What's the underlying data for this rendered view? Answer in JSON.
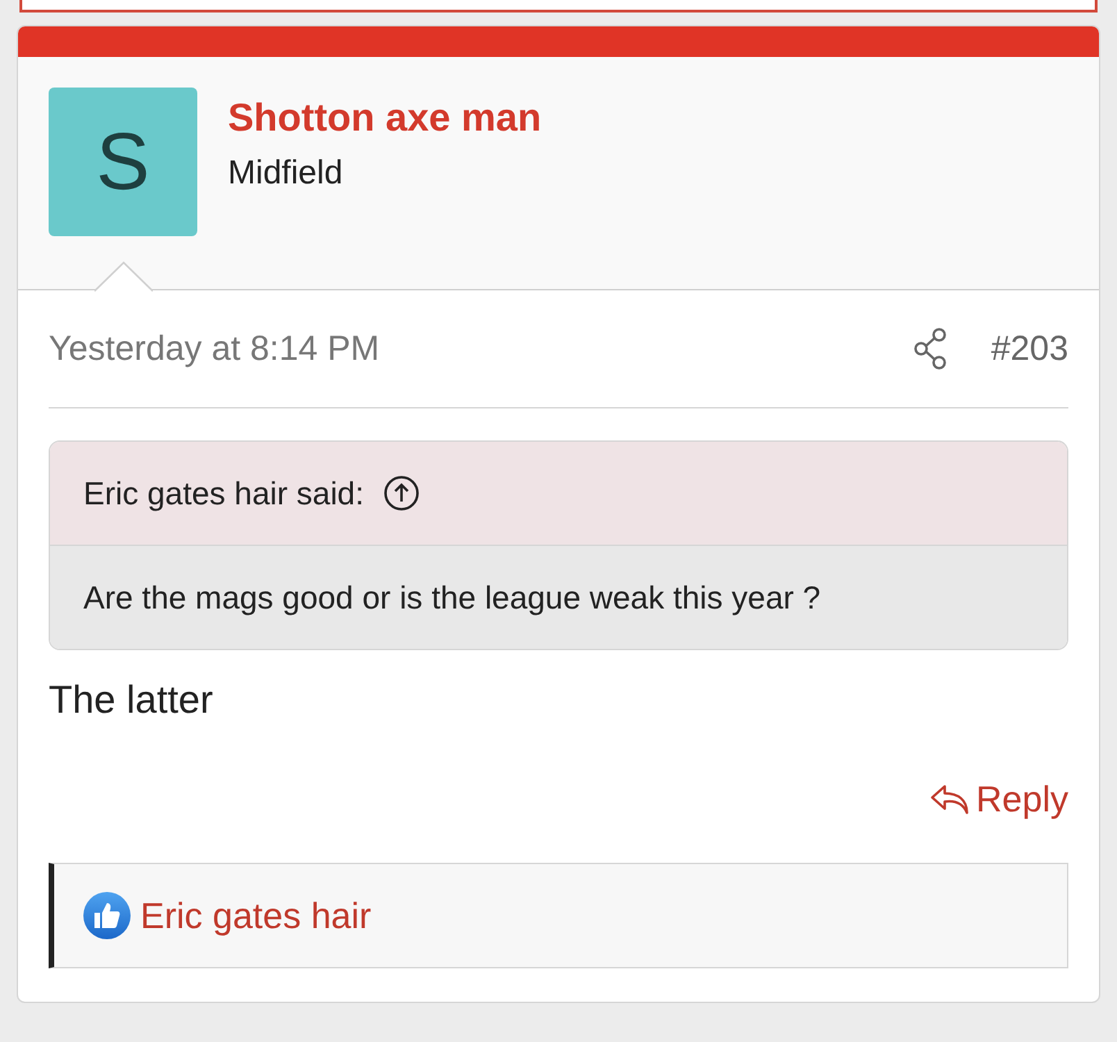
{
  "post": {
    "author": {
      "name": "Shotton axe man",
      "initial": "S",
      "title": "Midfield"
    },
    "time": "Yesterday at 8:14 PM",
    "number": "#203",
    "quote": {
      "attribution": "Eric gates hair said:",
      "text": "Are the mags good or is the league weak this year ?"
    },
    "body": "The latter",
    "reply_label": "Reply",
    "reactions": [
      {
        "user": "Eric gates hair"
      }
    ]
  }
}
